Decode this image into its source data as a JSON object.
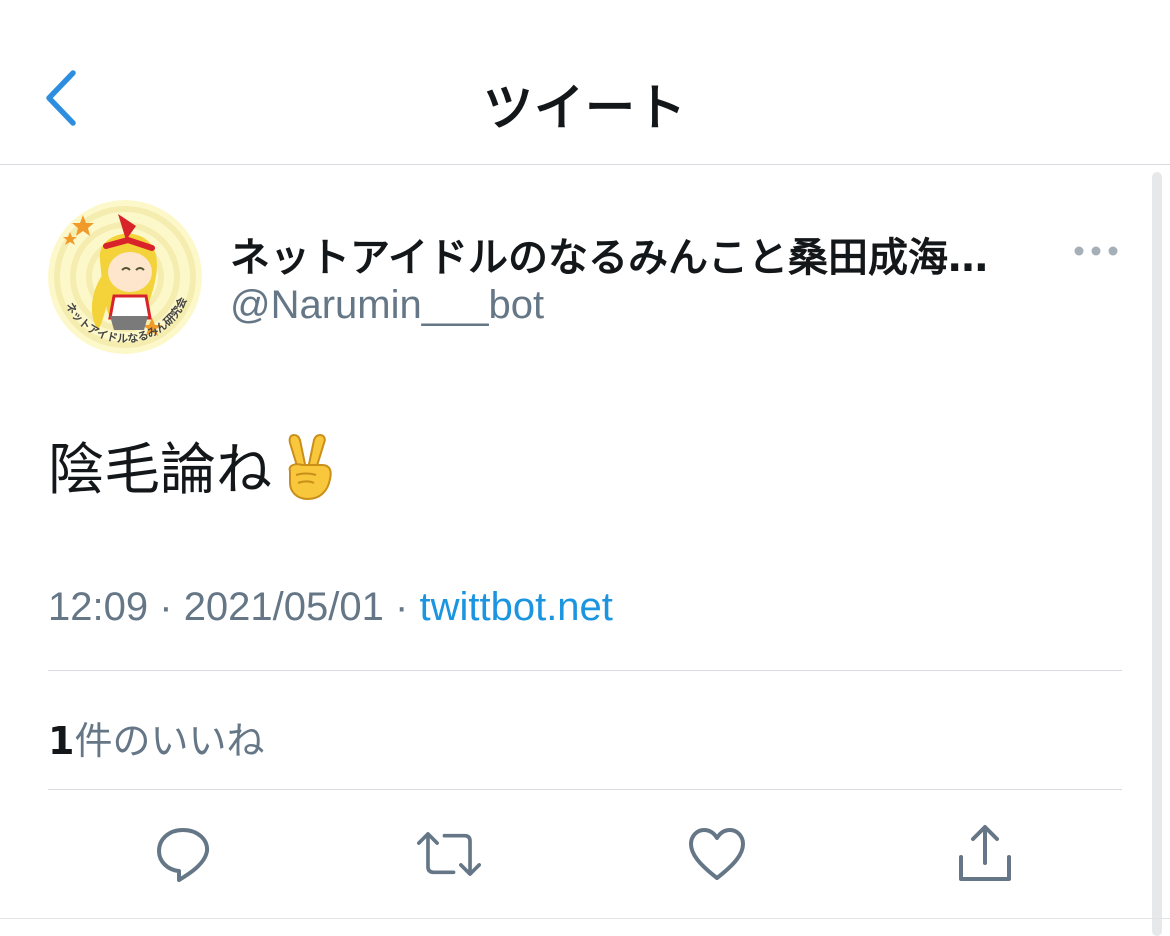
{
  "nav": {
    "title": "ツイート",
    "back_icon": "chevron-left-icon"
  },
  "tweet": {
    "display_name": "ネットアイドルのなるみんこと桑田成海…",
    "handle": "@Narumin___bot",
    "text": "陰毛論ね",
    "emoji": "victory-hand-icon",
    "time": "12:09",
    "date": "2021/05/01",
    "separator": "·",
    "source": "twittbot.net",
    "likes_count": "1",
    "likes_label": "件のいいね",
    "avatar_text": "ネットアイドルなるみん研究会"
  },
  "actions": [
    {
      "name": "reply",
      "icon": "reply-icon"
    },
    {
      "name": "retweet",
      "icon": "retweet-icon"
    },
    {
      "name": "like",
      "icon": "heart-icon"
    },
    {
      "name": "share",
      "icon": "share-icon"
    }
  ],
  "colors": {
    "accent": "#1b95e0",
    "muted": "#657786",
    "text": "#14171a",
    "divider": "#d8dce0"
  }
}
